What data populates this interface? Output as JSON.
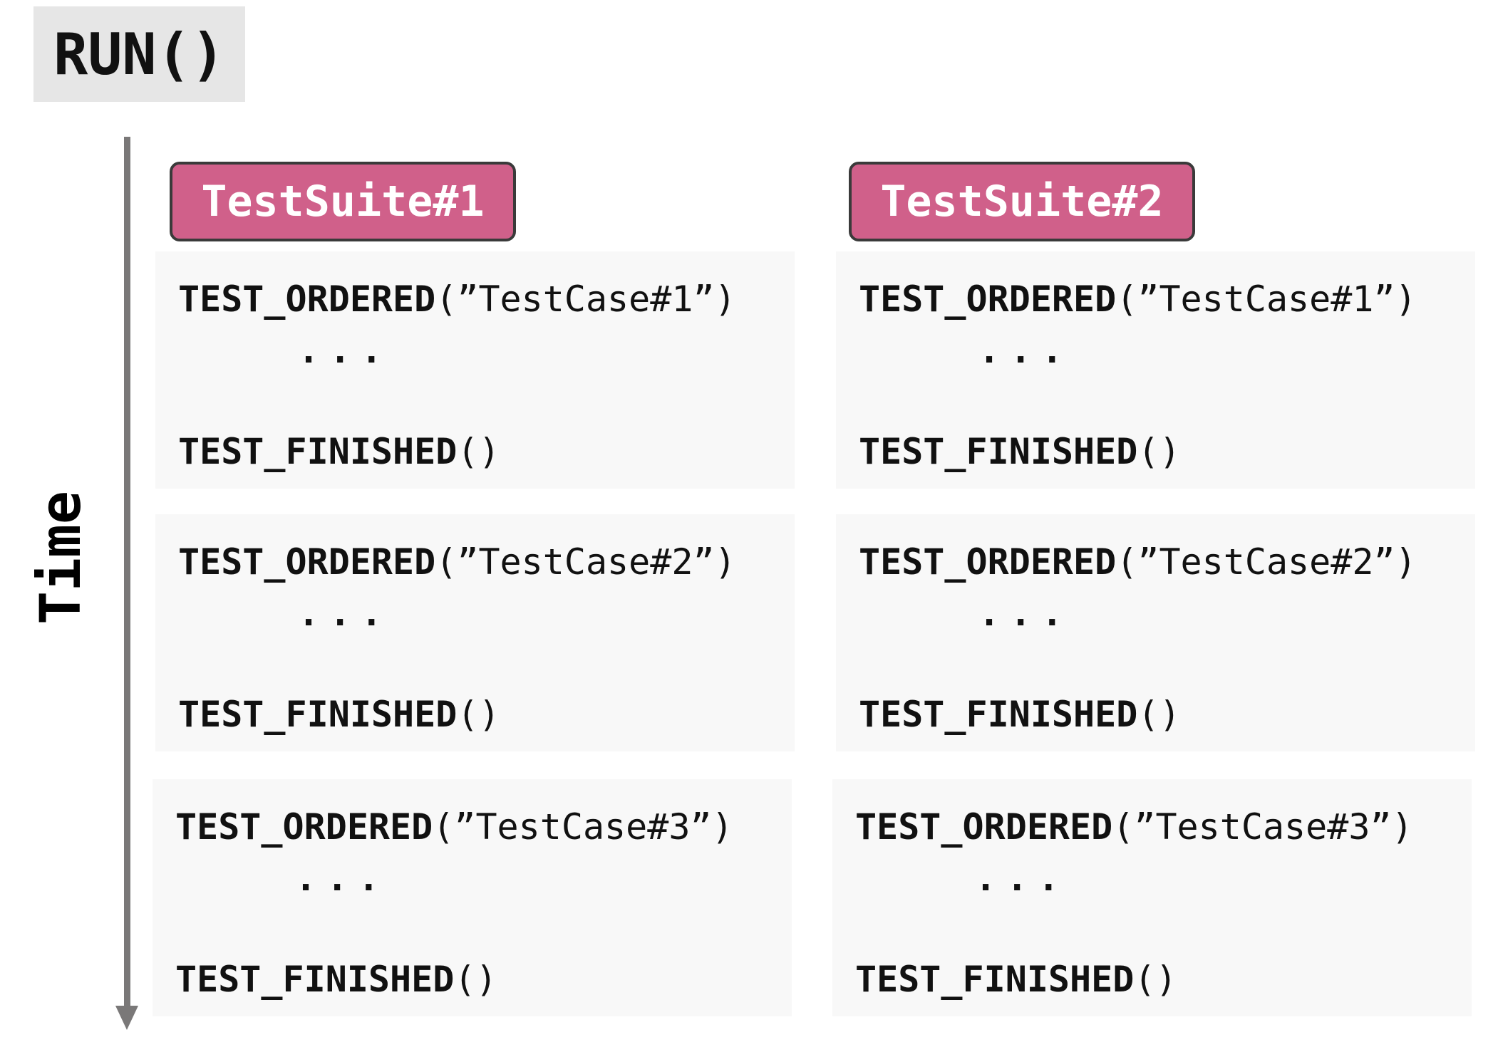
{
  "run": {
    "label": "RUN()"
  },
  "axis": {
    "label": "Time"
  },
  "suites": [
    {
      "label": "TestSuite#1",
      "cases": [
        {
          "ordered_kw": "TEST_ORDERED",
          "ordered_arg": "(”TestCase#1”)",
          "ellipsis": "...",
          "finished_kw": "TEST_FINISHED",
          "finished_arg": "()"
        },
        {
          "ordered_kw": "TEST_ORDERED",
          "ordered_arg": "(”TestCase#2”)",
          "ellipsis": "...",
          "finished_kw": "TEST_FINISHED",
          "finished_arg": "()"
        },
        {
          "ordered_kw": "TEST_ORDERED",
          "ordered_arg": "(”TestCase#3”)",
          "ellipsis": "...",
          "finished_kw": "TEST_FINISHED",
          "finished_arg": "()"
        }
      ]
    },
    {
      "label": "TestSuite#2",
      "cases": [
        {
          "ordered_kw": "TEST_ORDERED",
          "ordered_arg": "(”TestCase#1”)",
          "ellipsis": "...",
          "finished_kw": "TEST_FINISHED",
          "finished_arg": "()"
        },
        {
          "ordered_kw": "TEST_ORDERED",
          "ordered_arg": "(”TestCase#2”)",
          "ellipsis": "...",
          "finished_kw": "TEST_FINISHED",
          "finished_arg": "()"
        },
        {
          "ordered_kw": "TEST_ORDERED",
          "ordered_arg": "(”TestCase#3”)",
          "ellipsis": "...",
          "finished_kw": "TEST_FINISHED",
          "finished_arg": "()"
        }
      ]
    }
  ],
  "colors": {
    "suite_fill": "#d0608a",
    "suite_border": "#3a3a3a",
    "run_bg": "#e6e6e6",
    "block_bg": "#f8f8f8",
    "axis": "#7a7878"
  }
}
